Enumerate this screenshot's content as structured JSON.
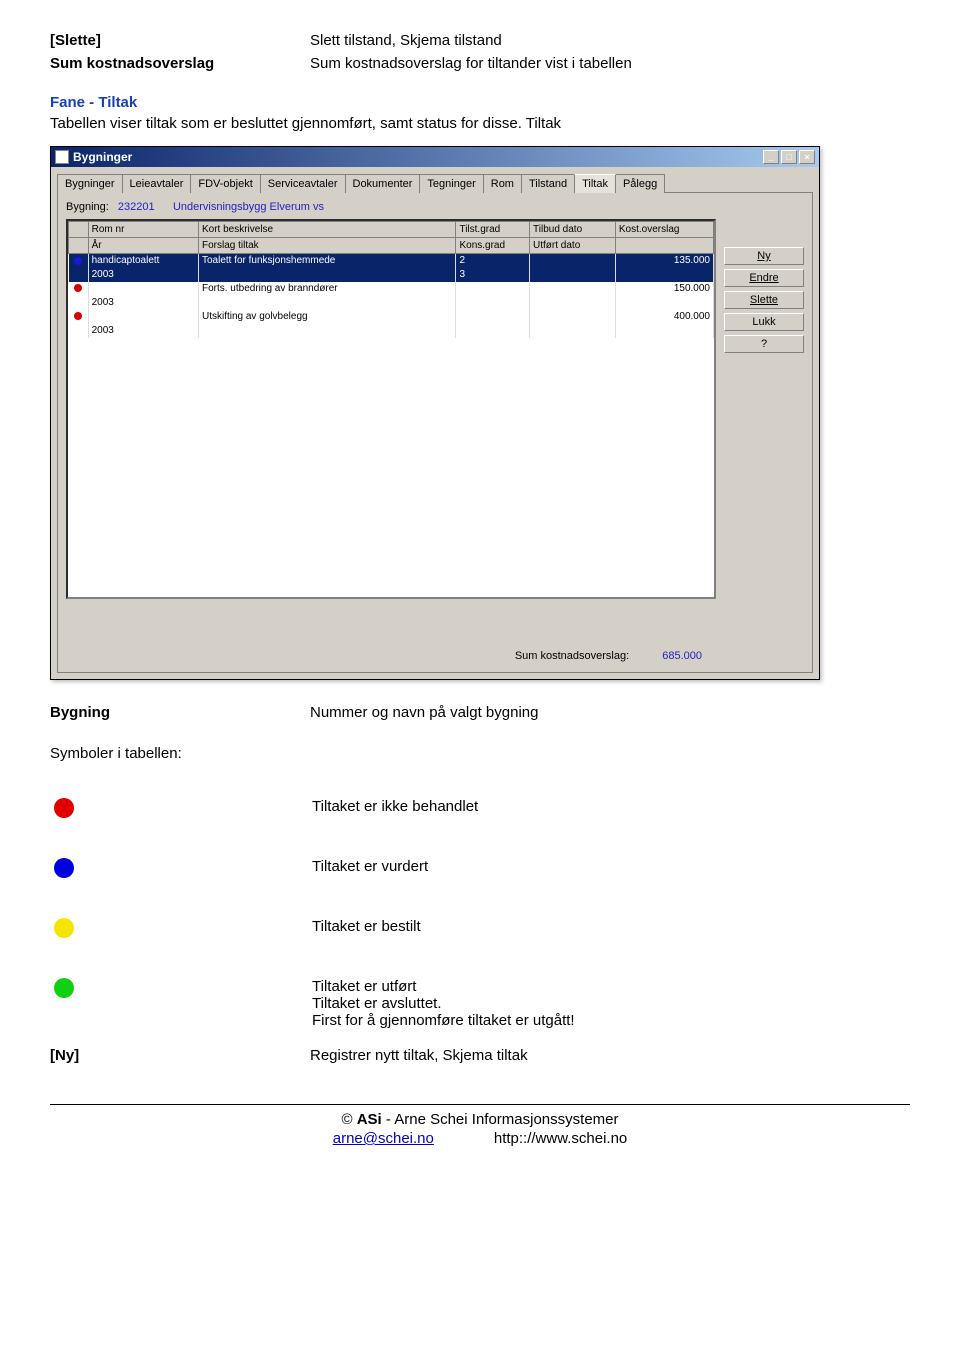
{
  "defs": {
    "slette_term": "[Slette]",
    "slette_desc": "Slett tilstand, Skjema tilstand",
    "sum_term": "Sum kostnadsoverslag",
    "sum_desc": "Sum kostnadsoverslag for tiltander vist i tabellen"
  },
  "section": {
    "title": "Fane - Tiltak",
    "para": "Tabellen viser tiltak som er besluttet gjennomført, samt status for disse. Tiltak"
  },
  "window": {
    "title": "Bygninger",
    "tabs": [
      "Bygninger",
      "Leieavtaler",
      "FDV-objekt",
      "Serviceavtaler",
      "Dokumenter",
      "Tegninger",
      "Rom",
      "Tilstand",
      "Tiltak",
      "Pålegg"
    ],
    "active_tab_index": 8,
    "bygning_label": "Bygning:",
    "bygning_nr": "232201",
    "bygning_name": "Undervisningsbygg Elverum vs",
    "headers_row1": [
      "",
      "Rom nr",
      "Kort beskrivelse",
      "Tilst.grad",
      "Tilbud dato",
      "Kost.overslag"
    ],
    "headers_row2": [
      "",
      "År",
      "Forslag tiltak",
      "Kons.grad",
      "Utført dato",
      ""
    ],
    "rows": [
      {
        "dot": "blue",
        "c1": "handicaptoalett",
        "c2": "Toalett for funksjonshemmede",
        "c3": "2",
        "c4": "",
        "c5": "135.000",
        "sel": true
      },
      {
        "dot": "",
        "c1": "2003",
        "c2": "",
        "c3": "3",
        "c4": "",
        "c5": "",
        "sel": true
      },
      {
        "dot": "red",
        "c1": "",
        "c2": "Forts. utbedring av branndører",
        "c3": "",
        "c4": "",
        "c5": "150.000",
        "sel": false
      },
      {
        "dot": "",
        "c1": "2003",
        "c2": "",
        "c3": "",
        "c4": "",
        "c5": "",
        "sel": false
      },
      {
        "dot": "red",
        "c1": "",
        "c2": "Utskifting av golvbelegg",
        "c3": "",
        "c4": "",
        "c5": "400.000",
        "sel": false
      },
      {
        "dot": "",
        "c1": "2003",
        "c2": "",
        "c3": "",
        "c4": "",
        "c5": "",
        "sel": false
      }
    ],
    "buttons": {
      "ny": "Ny",
      "endre": "Endre",
      "slette": "Slette",
      "lukk": "Lukk",
      "help": "?"
    },
    "sum_label": "Sum kostnadsoverslag:",
    "sum_value": "685.000"
  },
  "lower": {
    "bygning_term": "Bygning",
    "bygning_desc": "Nummer og navn på valgt bygning",
    "symbols_label": "Symboler i tabellen:",
    "red_desc": "Tiltaket er ikke behandlet",
    "blue_desc": "Tiltaket er vurdert",
    "yellow_desc": "Tiltaket er bestilt",
    "green_desc_l1": "Tiltaket er utført",
    "green_desc_l2": "Tiltaket er avsluttet.",
    "green_desc_l3": "First for å gjennomføre tiltaket er utgått!",
    "ny_term": "[Ny]",
    "ny_desc": "Registrer nytt tiltak, Skjema tiltak"
  },
  "footer": {
    "line1_pre": "© ",
    "line1_bold": "ASi",
    "line1_rest": " - Arne Schei Informasjonssystemer",
    "email": "arne@schei.no",
    "url": "http:://www.schei.no"
  }
}
